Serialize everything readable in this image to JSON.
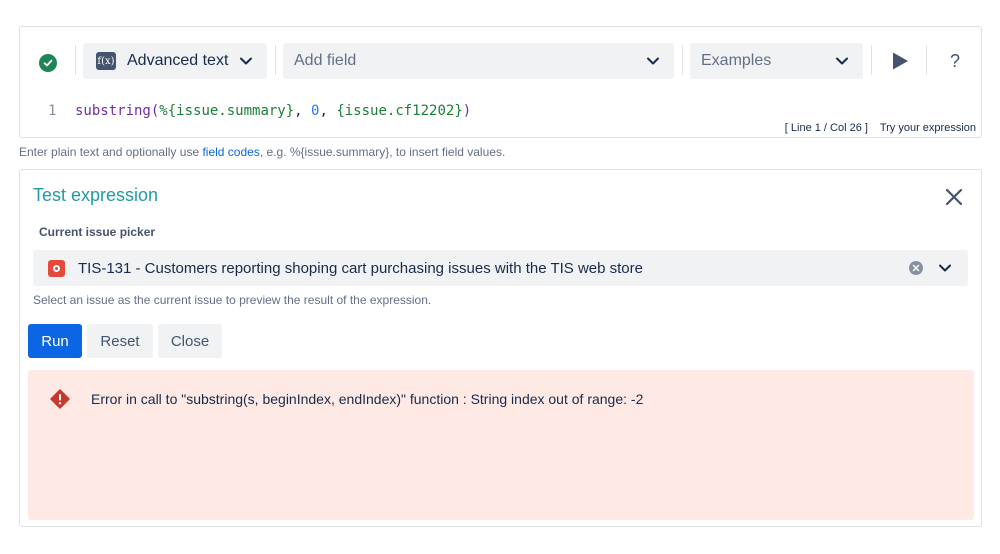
{
  "editor": {
    "status_icon": "check-circle-icon",
    "mode_icon_label": "f(x)",
    "mode_label": "Advanced text",
    "field_placeholder": "Add field",
    "examples_placeholder": "Examples",
    "help_label": "?",
    "line_number": "1",
    "code": {
      "fn": "substring(",
      "field1": "%{issue.summary}",
      "comma1": ", ",
      "num": "0",
      "comma2": ", ",
      "field2": "{issue.cf12202}",
      "close": ")"
    },
    "cursor_position": "[ Line 1 / Col 26 ]",
    "try_link": "Try your expression"
  },
  "help_text": {
    "before": "Enter plain text and optionally use ",
    "link": "field codes",
    "after": ", e.g. %{issue.summary}, to insert field values."
  },
  "test_panel": {
    "title": "Test expression",
    "picker_label": "Current issue picker",
    "selected_issue": "TIS-131 - Customers reporting shoping cart purchasing issues with the TIS web store",
    "picker_help": "Select an issue as the current issue to preview the result of the expression.",
    "buttons": {
      "run": "Run",
      "reset": "Reset",
      "close": "Close"
    },
    "error_message": "Error in call to \"substring(s, beginIndex, endIndex)\" function : String index out of range: -2"
  },
  "colors": {
    "accent": "#0c66e4",
    "title": "#1f9aa8",
    "success": "#1f845a",
    "error": "#c9372c",
    "error_bg": "#ffe9e5"
  }
}
